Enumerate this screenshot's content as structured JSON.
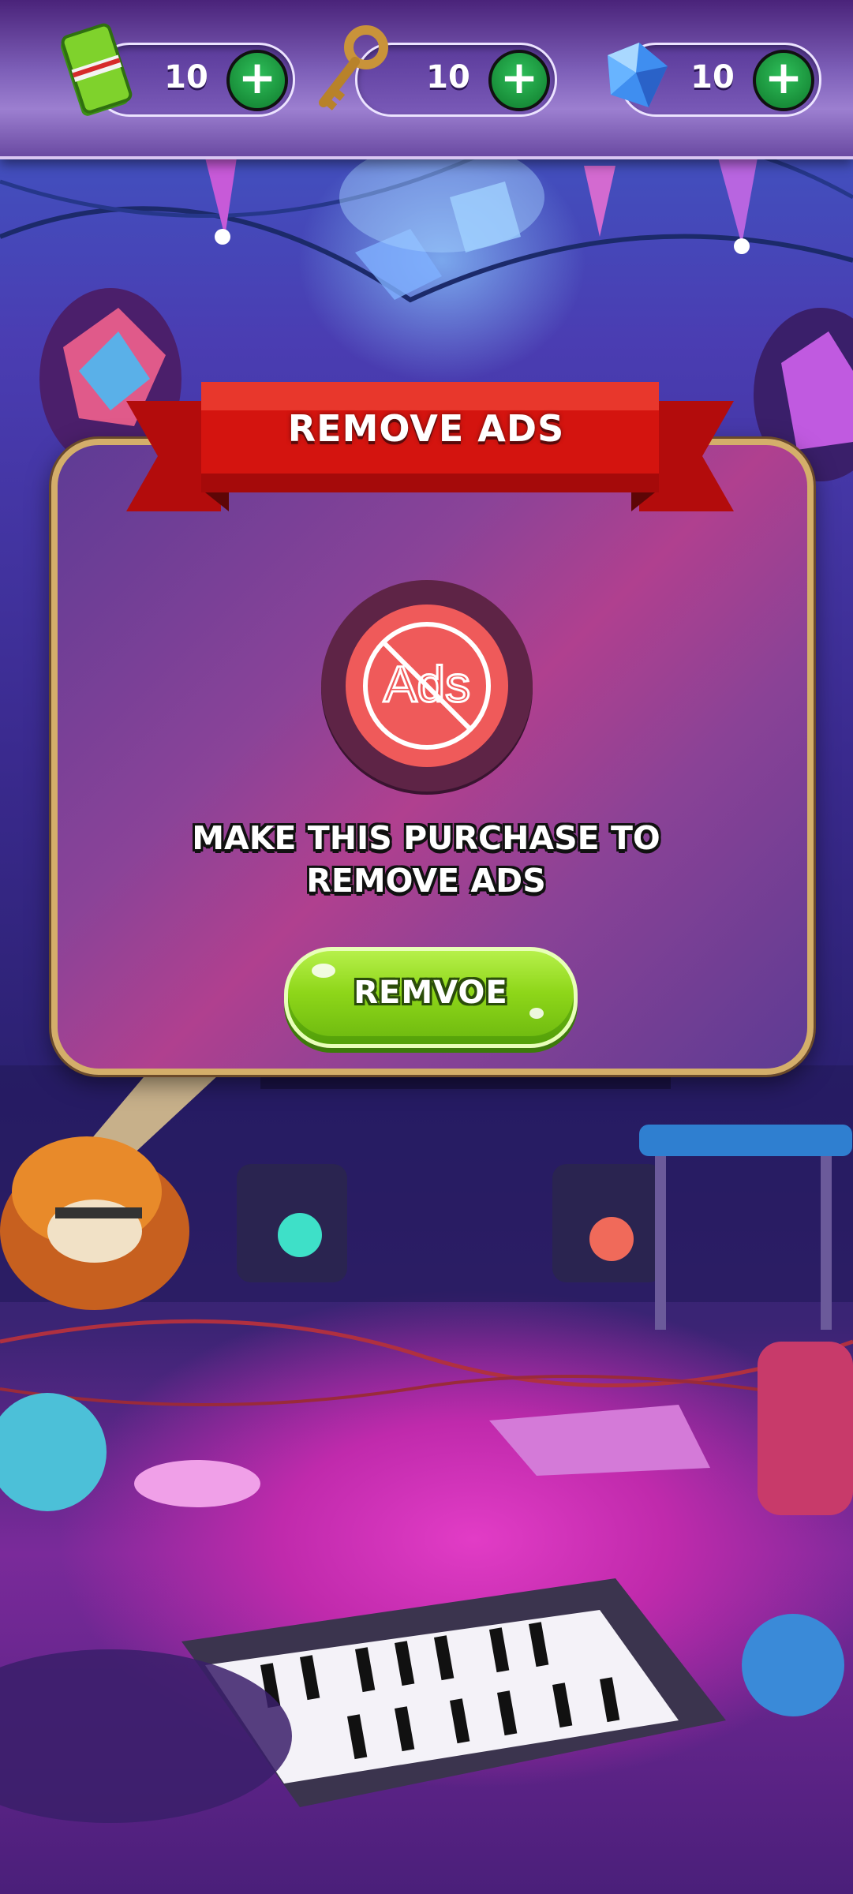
{
  "currencies": [
    {
      "name": "cash",
      "value": "10",
      "add_label": "+"
    },
    {
      "name": "key",
      "value": "10",
      "add_label": "+"
    },
    {
      "name": "gem",
      "value": "10",
      "add_label": "+"
    }
  ],
  "dialog": {
    "title": "REMOVE ADS",
    "icon_text": "Ads",
    "message_line1": "MAKE THIS PURCHASE TO",
    "message_line2": "REMOVE ADS",
    "button_label": "REMVOE"
  },
  "colors": {
    "ribbon": "#d4140f",
    "button": "#8ed619",
    "dialog_border": "#d4ae6a",
    "plus_button": "#1f9a44",
    "no_ads_icon": "#ef5a5a"
  }
}
